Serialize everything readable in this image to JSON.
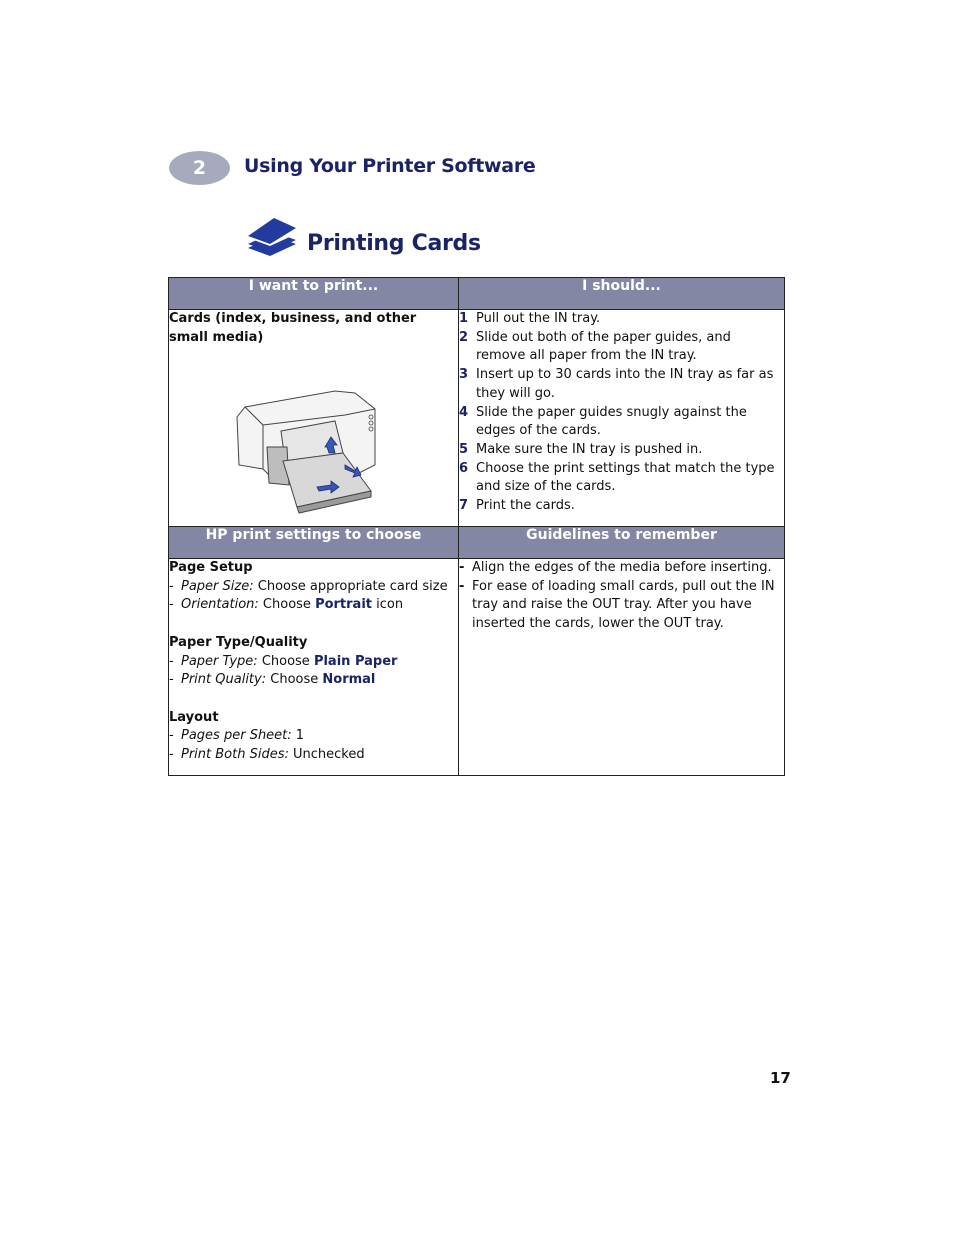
{
  "chapter": {
    "number": "2",
    "title": "Using Your Printer Software"
  },
  "section": {
    "icon": "stacked-cards-icon",
    "title": "Printing Cards"
  },
  "colors": {
    "header_bg": "#8387a4",
    "accent_navy": "#1b2366",
    "badge_bg": "#a7a9bd"
  },
  "table": {
    "headers": {
      "want_to_print": "I want to print...",
      "should": "I should...",
      "settings": "HP print settings to choose",
      "guidelines": "Guidelines to remember"
    },
    "media": "Cards (index, business, and other small media)",
    "printer_image": "printer-with-card-tray-illustration",
    "steps": [
      {
        "num": "1",
        "text": "Pull out the IN tray."
      },
      {
        "num": "2",
        "text": "Slide out both of the paper guides, and remove all paper from the IN tray."
      },
      {
        "num": "3",
        "text": "Insert up to 30 cards into the IN tray as far as they will go."
      },
      {
        "num": "4",
        "text": "Slide the paper guides snugly against the edges of the cards."
      },
      {
        "num": "5",
        "text": "Make sure the IN tray is pushed in."
      },
      {
        "num": "6",
        "text": "Choose the print settings that match the type and size of the cards."
      },
      {
        "num": "7",
        "text": "Print the cards."
      }
    ],
    "settings": {
      "page_setup": {
        "title": "Page Setup",
        "paper_size": {
          "label": "Paper Size:",
          "pre": "Choose appropriate card size"
        },
        "orientation": {
          "label": "Orientation:",
          "pre": "Choose",
          "value": "Portrait",
          "post": "icon"
        }
      },
      "paper_type_quality": {
        "title": "Paper Type/Quality",
        "paper_type": {
          "label": "Paper Type:",
          "pre": "Choose",
          "value": "Plain Paper"
        },
        "print_quality": {
          "label": "Print Quality:",
          "pre": "Choose",
          "value": "Normal"
        }
      },
      "layout": {
        "title": "Layout",
        "pages_per_sheet": {
          "label": "Pages per Sheet:",
          "value": "1"
        },
        "print_both_sides": {
          "label": "Print Both Sides:",
          "value": "Unchecked"
        }
      }
    },
    "guidelines": [
      "Align the edges of the media before inserting.",
      "For ease of loading small cards, pull out the IN tray and raise the OUT tray. After you have inserted the cards, lower the OUT tray."
    ],
    "dash": "-",
    "bullet": "-"
  },
  "page_number": "17"
}
